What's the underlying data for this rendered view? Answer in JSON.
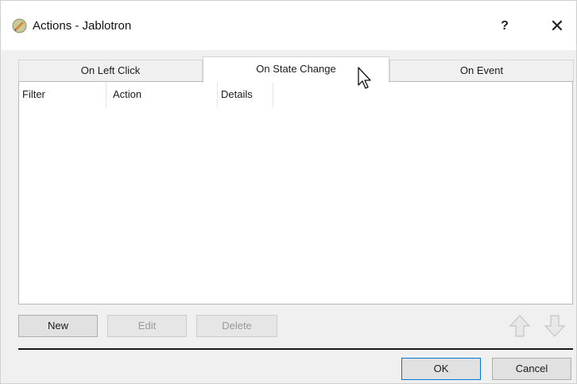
{
  "window": {
    "title": "Actions - Jablotron",
    "help_label": "?",
    "close_label": "✕"
  },
  "tabs": [
    {
      "label": "On Left Click",
      "selected": false
    },
    {
      "label": "On State Change",
      "selected": true
    },
    {
      "label": "On Event",
      "selected": false
    }
  ],
  "table": {
    "columns": [
      "Filter",
      "Action",
      "Details"
    ],
    "rows": []
  },
  "actions": {
    "new_label": "New",
    "edit_label": "Edit",
    "delete_label": "Delete"
  },
  "footer": {
    "ok_label": "OK",
    "cancel_label": "Cancel"
  },
  "icons": {
    "app": "jablotron-app-icon",
    "move_up": "arrow-up-icon",
    "move_down": "arrow-down-icon"
  },
  "colors": {
    "accent_focus": "#0078d7",
    "disabled_text": "#9a9a9a"
  }
}
